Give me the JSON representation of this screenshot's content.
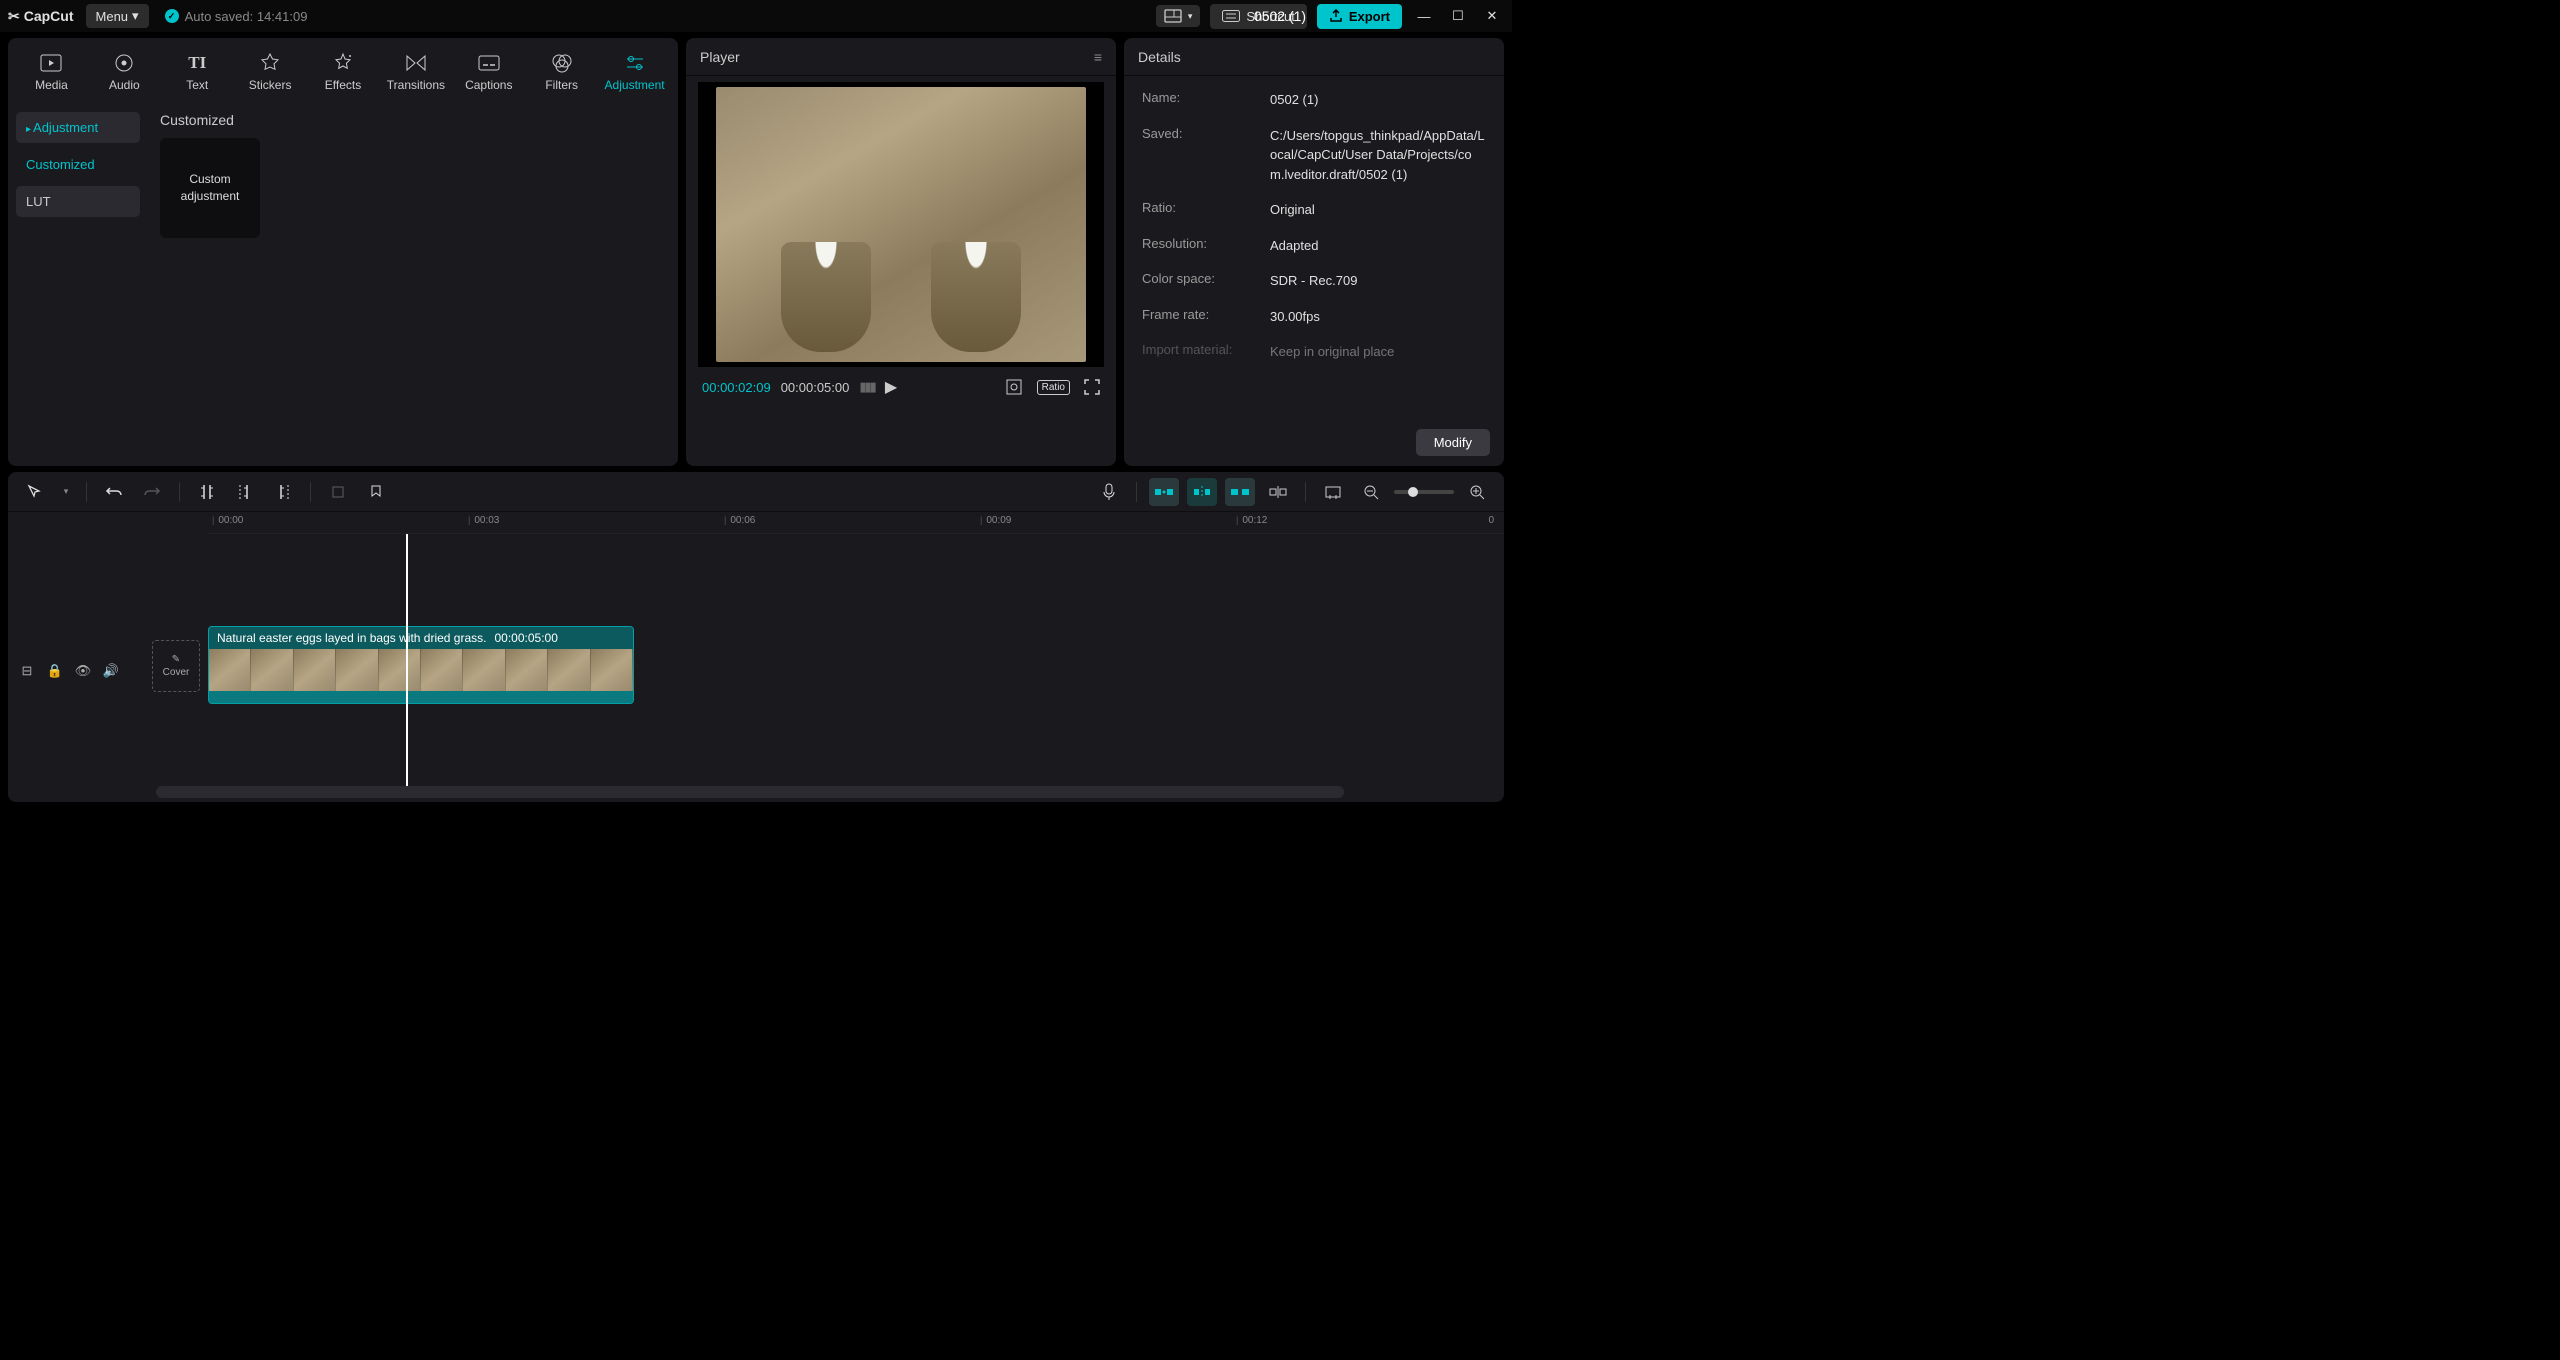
{
  "titlebar": {
    "app_name": "CapCut",
    "menu_label": "Menu",
    "autosave_text": "Auto saved: 14:41:09",
    "project_title": "0502 (1)",
    "shortcut_label": "Shortcut",
    "export_label": "Export"
  },
  "tabs": {
    "media": "Media",
    "audio": "Audio",
    "text": "Text",
    "stickers": "Stickers",
    "effects": "Effects",
    "transitions": "Transitions",
    "captions": "Captions",
    "filters": "Filters",
    "adjustment": "Adjustment"
  },
  "adjustment_panel": {
    "sidebar": {
      "adjustment": "Adjustment",
      "customized": "Customized",
      "lut": "LUT"
    },
    "section_title": "Customized",
    "card_label": "Custom adjustment"
  },
  "player": {
    "title": "Player",
    "time_current": "00:00:02:09",
    "time_total": "00:00:05:00",
    "ratio_label": "Ratio"
  },
  "details": {
    "title": "Details",
    "rows": {
      "name_k": "Name:",
      "name_v": "0502 (1)",
      "saved_k": "Saved:",
      "saved_v": "C:/Users/topgus_thinkpad/AppData/Local/CapCut/User Data/Projects/com.lveditor.draft/0502 (1)",
      "ratio_k": "Ratio:",
      "ratio_v": "Original",
      "resolution_k": "Resolution:",
      "resolution_v": "Adapted",
      "colorspace_k": "Color space:",
      "colorspace_v": "SDR - Rec.709",
      "framerate_k": "Frame rate:",
      "framerate_v": "30.00fps",
      "import_k": "Import material:",
      "import_v": "Keep in original place"
    },
    "modify_label": "Modify"
  },
  "timeline": {
    "ruler": {
      "t0": "00:00",
      "t1": "00:03",
      "t2": "00:06",
      "t3": "00:09",
      "t4": "00:12",
      "end": "0"
    },
    "cover_label": "Cover",
    "clip_name": "Natural easter eggs layed in bags with dried grass.",
    "clip_duration": "00:00:05:00"
  }
}
